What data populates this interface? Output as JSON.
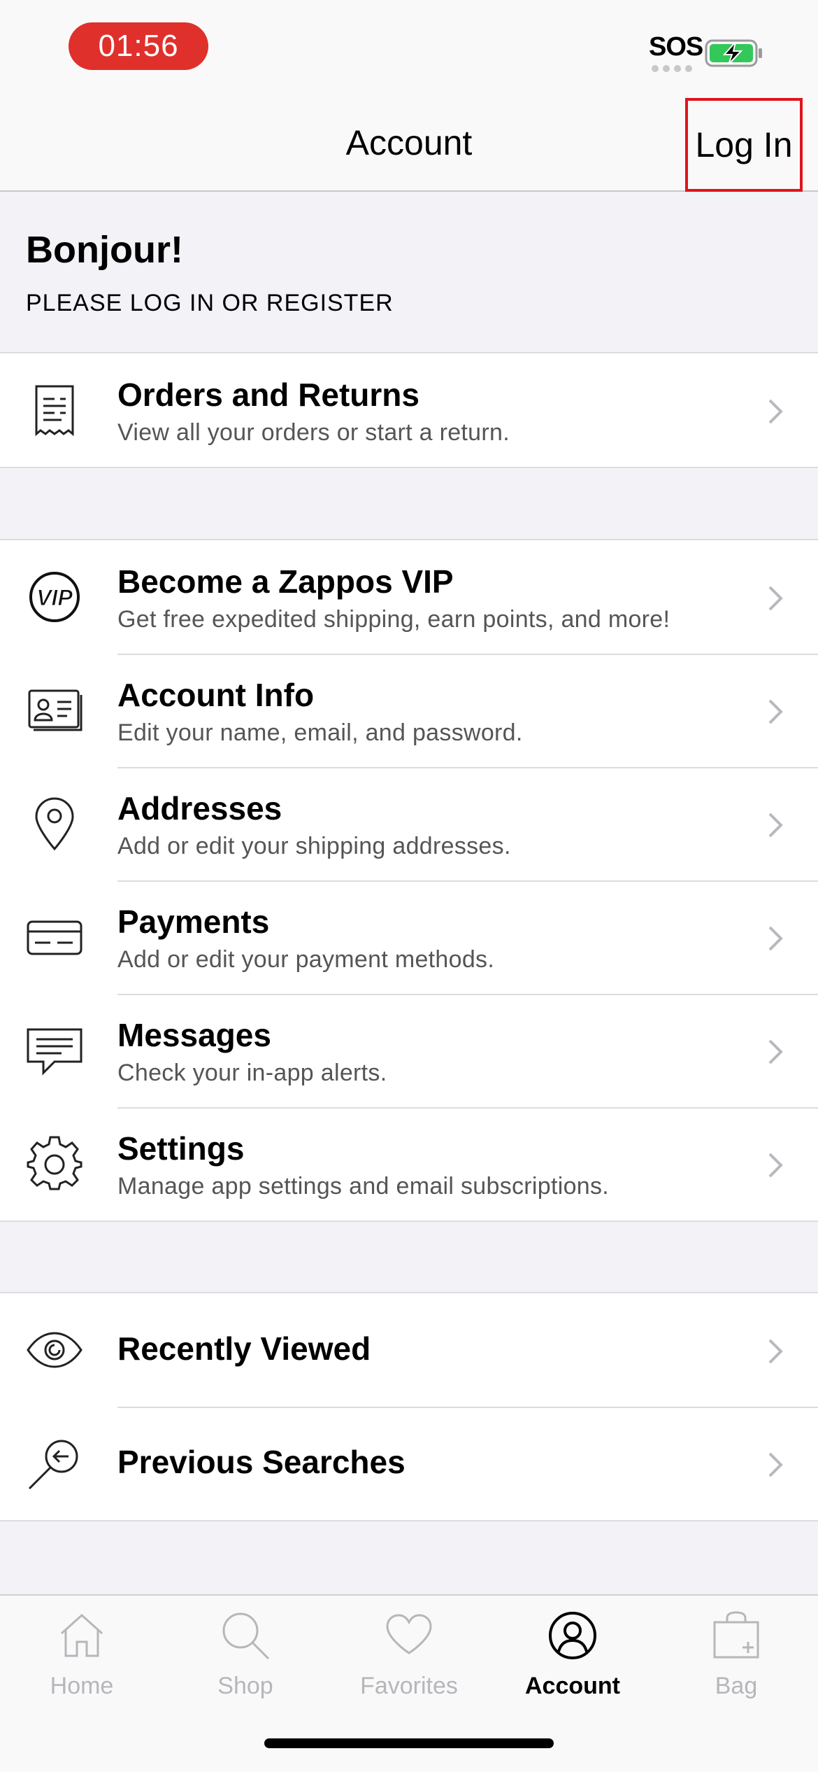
{
  "status_bar": {
    "time": "01:56",
    "carrier": "SOS",
    "battery_color": "#34c759"
  },
  "nav": {
    "title": "Account",
    "login_label": "Log In"
  },
  "greeting": {
    "title": "Bonjour!",
    "subtitle": "PLEASE LOG IN OR REGISTER"
  },
  "orders": {
    "title": "Orders and Returns",
    "subtitle": "View all your orders or start a return.",
    "icon": "receipt-icon"
  },
  "account_items": [
    {
      "title": "Become a Zappos VIP",
      "subtitle": "Get free expedited shipping, earn points, and more!",
      "icon": "vip-icon"
    },
    {
      "title": "Account Info",
      "subtitle": "Edit your name, email, and password.",
      "icon": "id-card-icon"
    },
    {
      "title": "Addresses",
      "subtitle": "Add or edit your shipping addresses.",
      "icon": "map-pin-icon"
    },
    {
      "title": "Payments",
      "subtitle": "Add or edit your payment methods.",
      "icon": "credit-card-icon"
    },
    {
      "title": "Messages",
      "subtitle": "Check your in-app alerts.",
      "icon": "message-icon"
    },
    {
      "title": "Settings",
      "subtitle": "Manage app settings and email subscriptions.",
      "icon": "gear-icon"
    }
  ],
  "history_items": [
    {
      "title": "Recently Viewed",
      "icon": "eye-icon"
    },
    {
      "title": "Previous Searches",
      "icon": "search-history-icon"
    }
  ],
  "tab_bar": {
    "tabs": [
      {
        "label": "Home",
        "icon": "home-icon"
      },
      {
        "label": "Shop",
        "icon": "search-icon"
      },
      {
        "label": "Favorites",
        "icon": "heart-icon"
      },
      {
        "label": "Account",
        "icon": "person-icon",
        "active": true
      },
      {
        "label": "Bag",
        "icon": "bag-icon"
      }
    ]
  }
}
